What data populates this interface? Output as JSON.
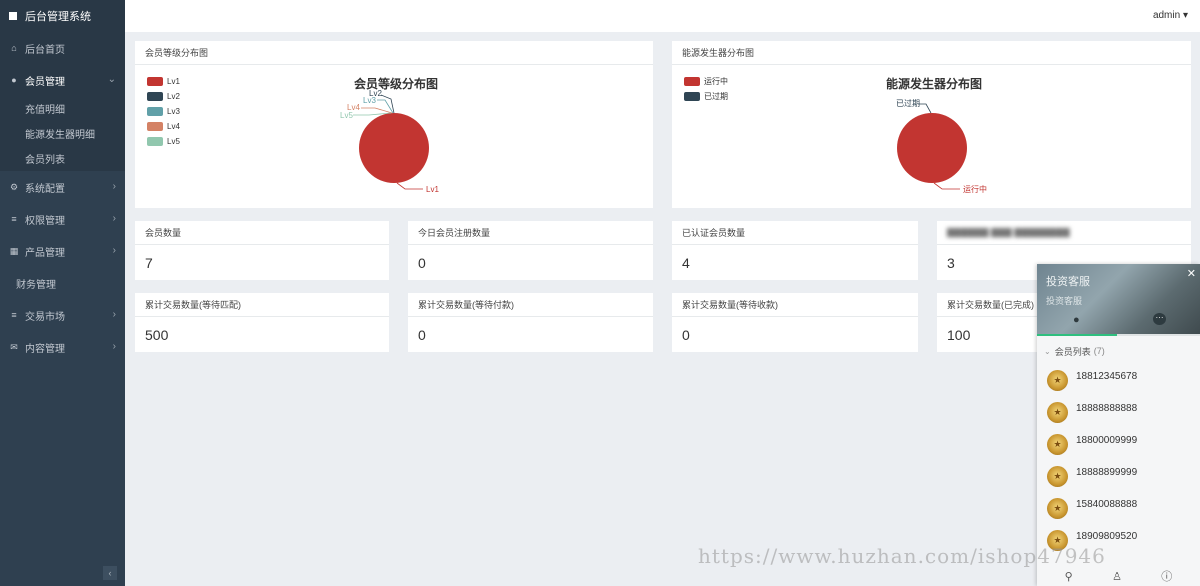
{
  "sidebar": {
    "brand": "后台管理系统",
    "home": "后台首页",
    "member": {
      "label": "会员管理",
      "subs": [
        "充值明细",
        "能源发生器明细",
        "会员列表"
      ]
    },
    "items": [
      "系统配置",
      "权限管理",
      "产品管理",
      "财务管理",
      "交易市场",
      "内容管理"
    ],
    "collapse_icon": "chevron-left-icon"
  },
  "header": {
    "user": "admin"
  },
  "charts": {
    "left_card_title": "会员等级分布图",
    "right_card_title": "能源发生器分布图"
  },
  "chart_data": [
    {
      "type": "pie",
      "title": "会员等级分布图",
      "categories": [
        "Lv1",
        "Lv2",
        "Lv3",
        "Lv4",
        "Lv5"
      ],
      "values": [
        7,
        0,
        0,
        0,
        0
      ],
      "colors": [
        "#c23531",
        "#2f4554",
        "#61a0a8",
        "#d48265",
        "#91c7ae"
      ],
      "legend_position": "top-left"
    },
    {
      "type": "pie",
      "title": "能源发生器分布图",
      "categories": [
        "运行中",
        "已过期"
      ],
      "values": [
        1,
        0
      ],
      "colors": [
        "#c23531",
        "#2f4554"
      ],
      "legend_position": "top-left"
    }
  ],
  "stats": [
    {
      "label": "会员数量",
      "value": "7"
    },
    {
      "label": "今日会员注册数量",
      "value": "0"
    },
    {
      "label": "已认证会员数量",
      "value": "4"
    },
    {
      "label": "",
      "value": "3"
    },
    {
      "label": "累计交易数量(等待匹配)",
      "value": "500"
    },
    {
      "label": "累计交易数量(等待付款)",
      "value": "0"
    },
    {
      "label": "累计交易数量(等待收款)",
      "value": "0"
    },
    {
      "label": "累计交易数量(已完成)",
      "value": "100"
    }
  ],
  "chat": {
    "title": "投资客服",
    "subtitle": "投资客服",
    "group_label": "会员列表",
    "group_count": "(7)",
    "contacts": [
      "18812345678",
      "18888888888",
      "18800009999",
      "18888899999",
      "15840088888",
      "18909809520"
    ]
  },
  "watermark": "https://www.huzhan.com/ishop47946"
}
